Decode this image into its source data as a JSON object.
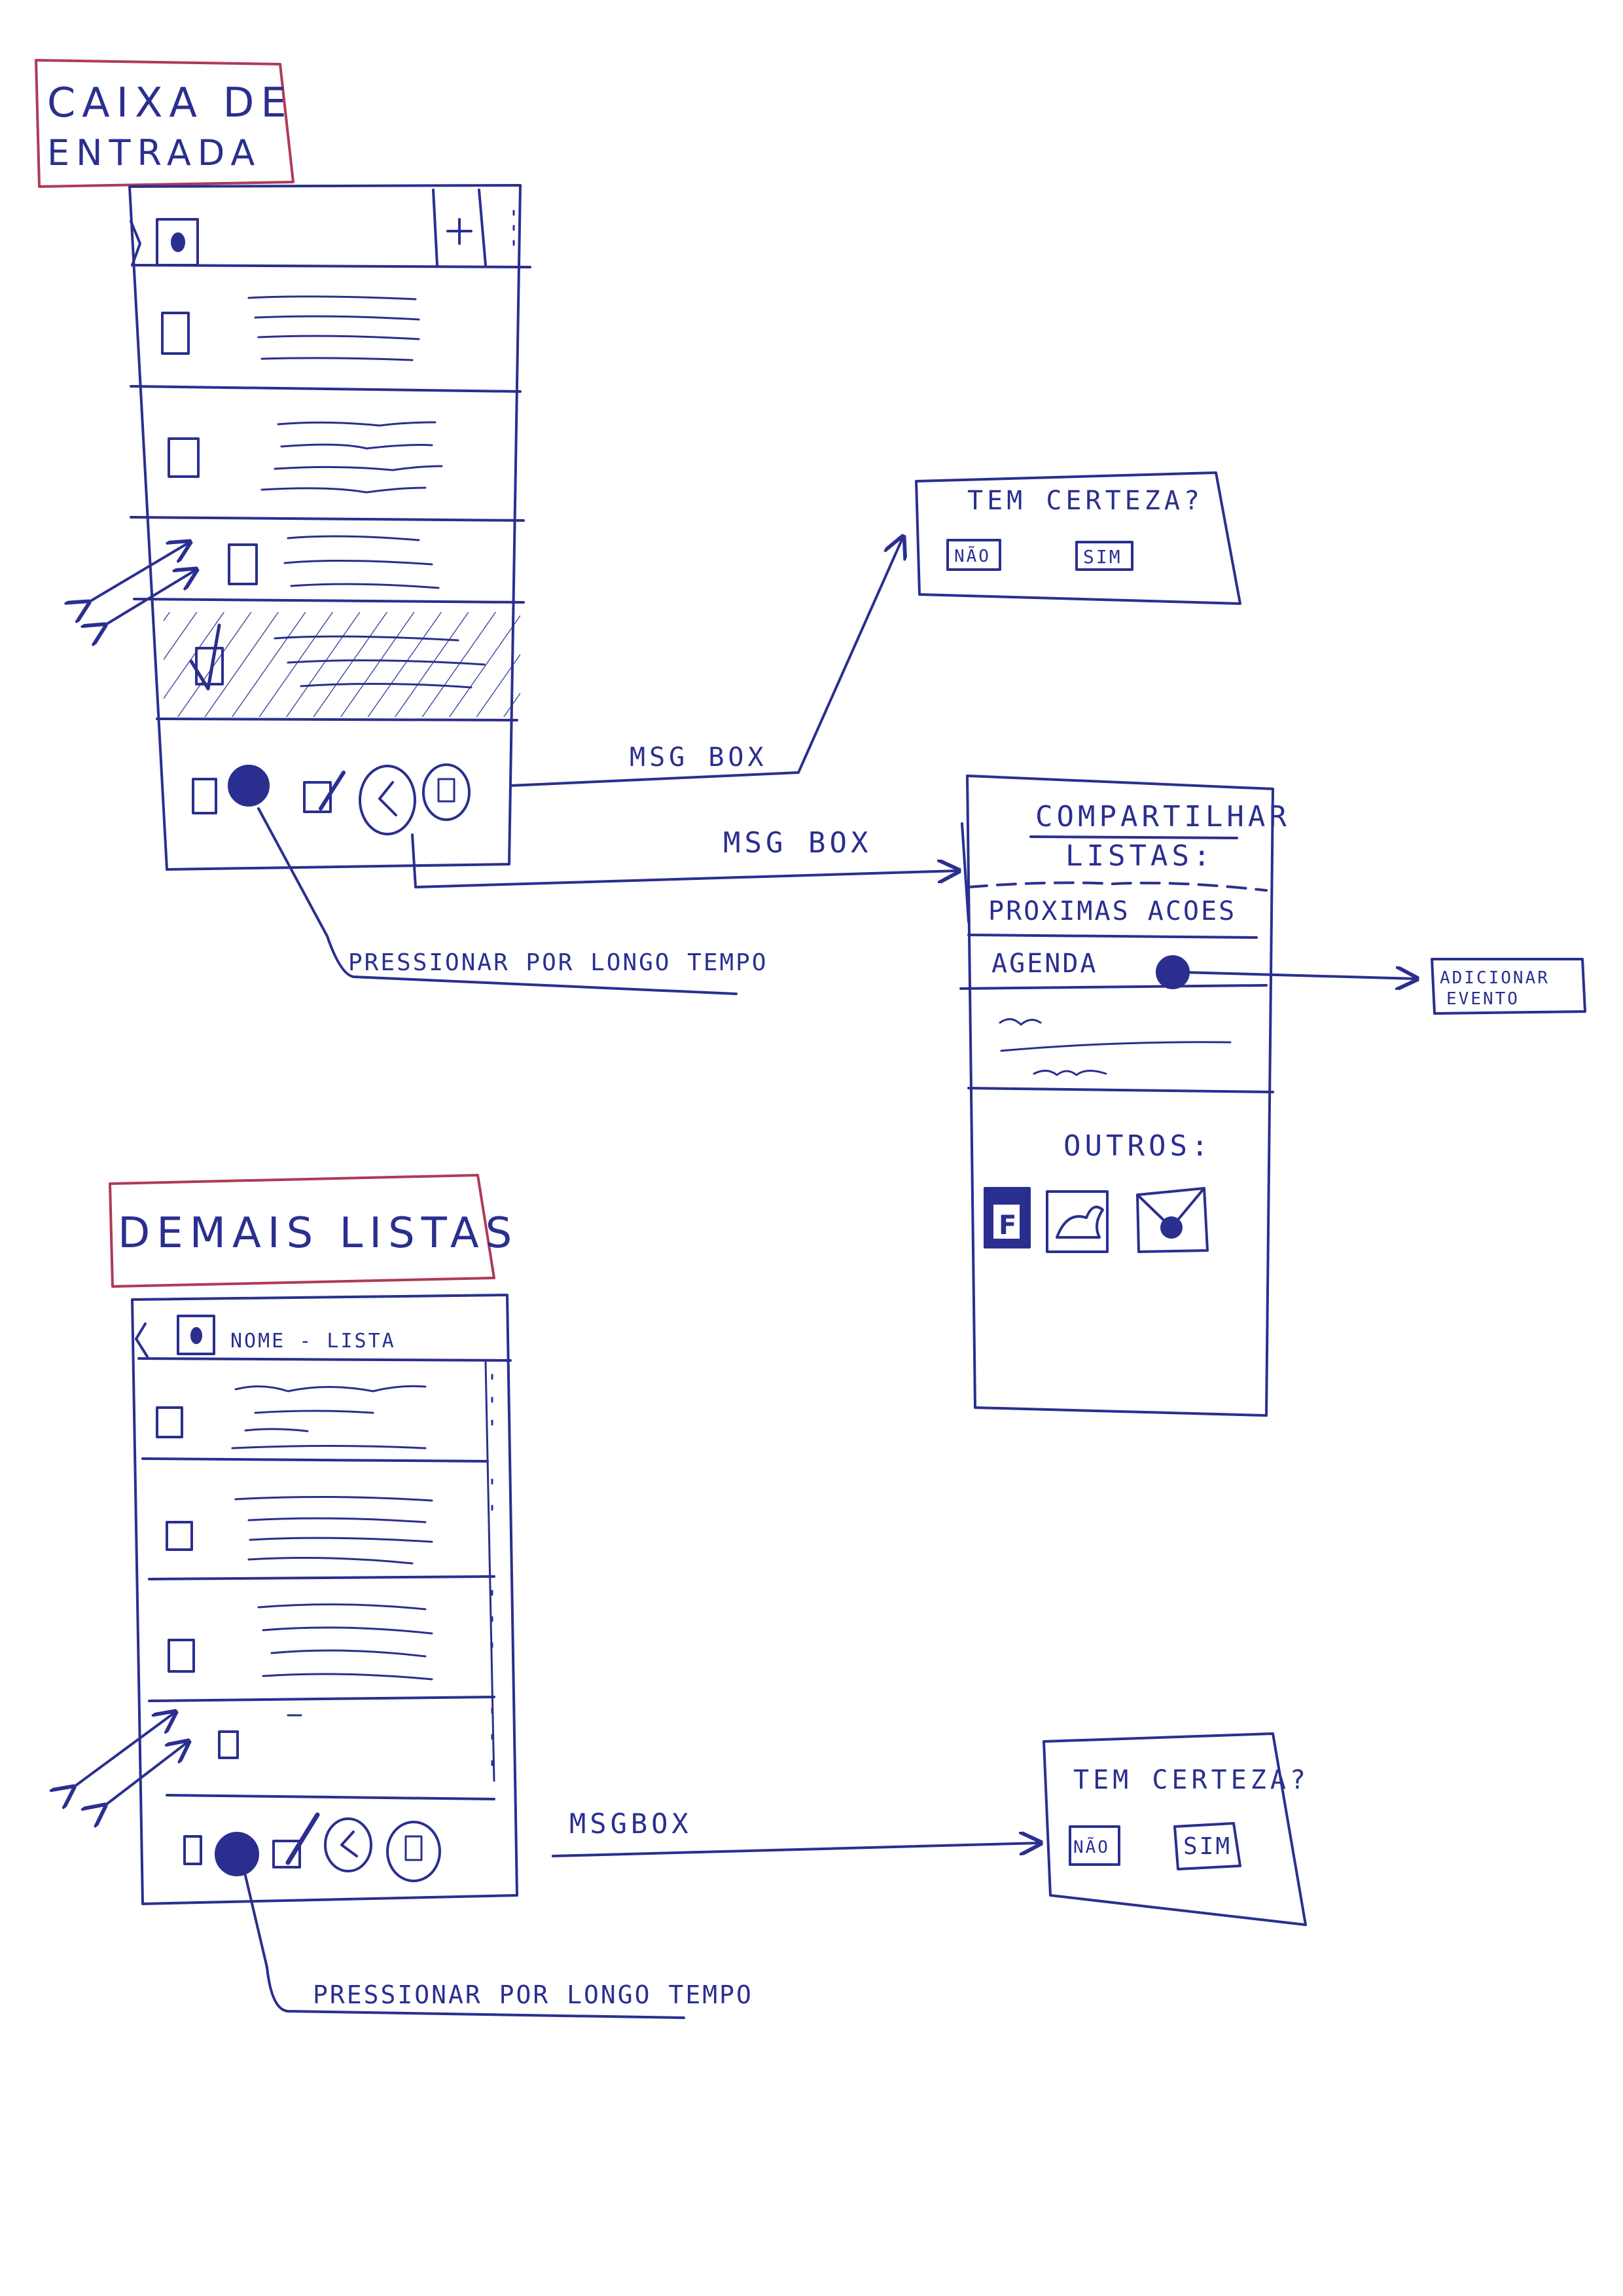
{
  "colors": {
    "ink": "#2a2f8f",
    "title_box": "#b03a55",
    "paper": "#ffffff"
  },
  "inbox_title": {
    "line1": "CAIXA DE",
    "line2": "ENTRADA"
  },
  "inbox_screen": {
    "header_icons": [
      "back-icon",
      "avatar-icon",
      "add-icon",
      "overflow-menu-icon"
    ],
    "add_label": "+",
    "toolbar_icons": [
      "checkbox-icon",
      "dot-icon",
      "edit-icon",
      "share-icon",
      "delete-icon"
    ]
  },
  "labels": {
    "msgbox_top": "MSG BOX",
    "msgbox_share": "MSG BOX",
    "msgbox_bottom": "MSGBOX",
    "long_press_top": "PRESSIONAR POR LONGO TEMPO",
    "long_press_bottom": "PRESSIONAR POR LONGO TEMPO"
  },
  "confirm_dialog_top": {
    "question": "TEM CERTEZA?",
    "no": "NÃO",
    "yes": "SIM"
  },
  "share_screen": {
    "title_line1": "COMPARTILHAR",
    "title_line2": "LISTAS:",
    "item_next_actions": "PROXIMAS ACOES",
    "item_agenda": "AGENDA",
    "others_label": "OUTROS:",
    "social_icons": [
      "facebook-icon",
      "twitter-bird-icon",
      "email-envelope-icon"
    ],
    "facebook_letter": "F"
  },
  "add_event": {
    "line1": "ADICIONAR",
    "line2": "EVENTO"
  },
  "other_lists_title": "DEMAIS LISTAS",
  "list_screen": {
    "header_title": "NOME - LISTA"
  },
  "confirm_dialog_bottom": {
    "question": "TEM CERTEZA?",
    "no": "NÃO",
    "yes": "SIM"
  }
}
